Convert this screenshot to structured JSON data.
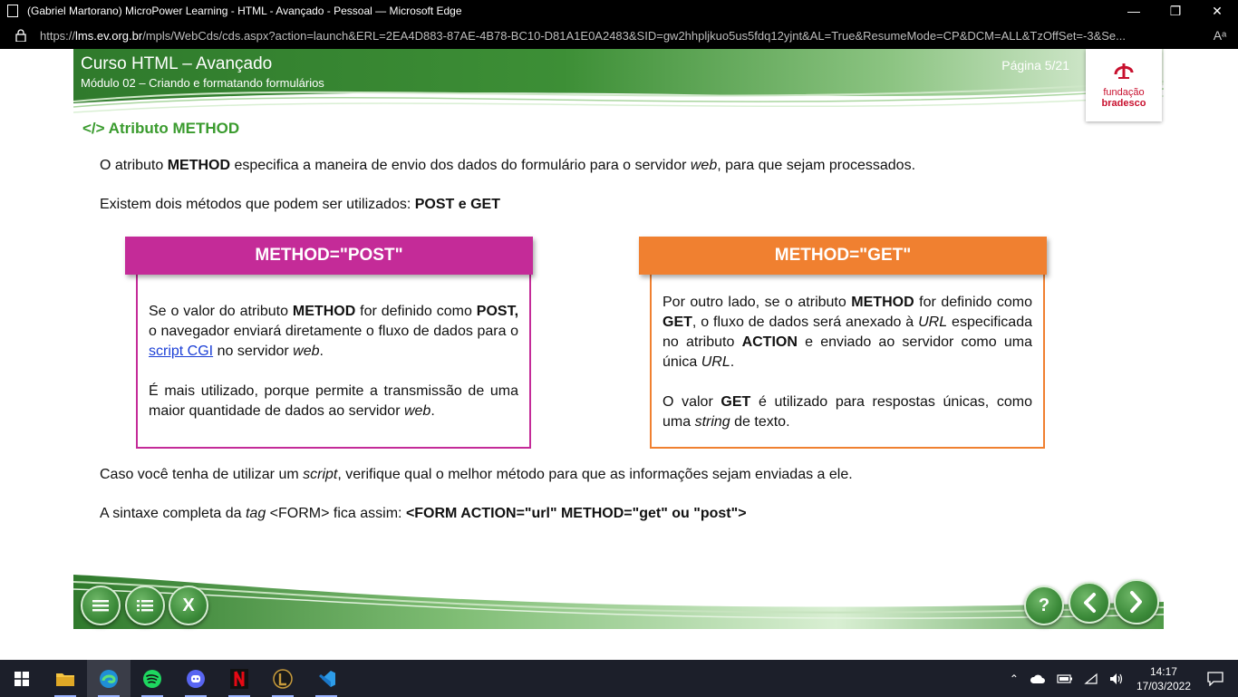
{
  "browser": {
    "window_title": "(Gabriel Martorano) MicroPower Learning - HTML - Avançado - Pessoal — Microsoft Edge",
    "url_prefix": "https://",
    "url_host": "lms.ev.org.br",
    "url_rest": "/mpls/WebCds/cds.aspx?action=launch&ERL=2EA4D883-87AE-4B78-BC10-D81A1E0A2483&SID=gw2hhpljkuo5us5fdq12yjnt&AL=True&ResumeMode=CP&DCM=ALL&TzOffSet=-3&Se..."
  },
  "course": {
    "title": "Curso HTML – Avançado",
    "module": "Módulo 02 – Criando e formatando formulários",
    "page": "Página 5/21",
    "logo_line1": "fundação",
    "logo_line2": "bradesco"
  },
  "content": {
    "section_title": "</> Atributo METHOD",
    "p1": {
      "a": "O atributo ",
      "b": "METHOD",
      "c": " especifica a maneira de envio dos dados do formulário para o servidor ",
      "d": "web",
      "e": ", para que sejam processados."
    },
    "p2": {
      "a": "Existem dois métodos que podem ser utilizados: ",
      "b": "POST e GET"
    },
    "post_box": {
      "heading": "METHOD=\"POST\"",
      "p1_a": "Se o valor do atributo ",
      "p1_b": "METHOD",
      "p1_c": " for definido como ",
      "p1_d": "POST,",
      "p1_e": " o navegador enviará diretamente o fluxo de dados para o ",
      "p1_link": "script CGI",
      "p1_f": "  no servidor ",
      "p1_g": "web",
      "p1_h": ".",
      "p2_a": "É mais utilizado, porque permite a transmissão de uma maior quantidade de dados ao servidor ",
      "p2_b": "web",
      "p2_c": "."
    },
    "get_box": {
      "heading": "METHOD=\"GET\"",
      "p1_a": "Por outro lado, se o atributo ",
      "p1_b": "METHOD",
      "p1_c": " for definido como ",
      "p1_d": "GET",
      "p1_e": ", o fluxo de dados será anexado à ",
      "p1_f": "URL",
      "p1_g": " especificada no atributo ",
      "p1_h": "ACTION",
      "p1_i": " e enviado ao servidor como uma única ",
      "p1_j": "URL",
      "p1_k": ".",
      "p2_a": "O valor ",
      "p2_b": "GET",
      "p2_c": " é utilizado para respostas únicas, como uma ",
      "p2_d": "string",
      "p2_e": " de texto."
    },
    "p3": {
      "a": "Caso você tenha de utilizar um ",
      "b": "script",
      "c": ", verifique qual o melhor método para que as informações sejam enviadas a ele."
    },
    "p4": {
      "a": "A sintaxe completa da ",
      "b": "tag",
      "c": " <FORM> fica assim: ",
      "d": "<FORM ACTION=\"url\" METHOD=\"get\" ou \"post\">"
    }
  },
  "nav": {
    "close_label": "X",
    "help_label": "?"
  },
  "taskbar": {
    "time": "14:17",
    "date": "17/03/2022"
  },
  "colors": {
    "post": "#c42b98",
    "get": "#f08030",
    "section": "#3a9b2e",
    "link": "#1b3fd6"
  }
}
